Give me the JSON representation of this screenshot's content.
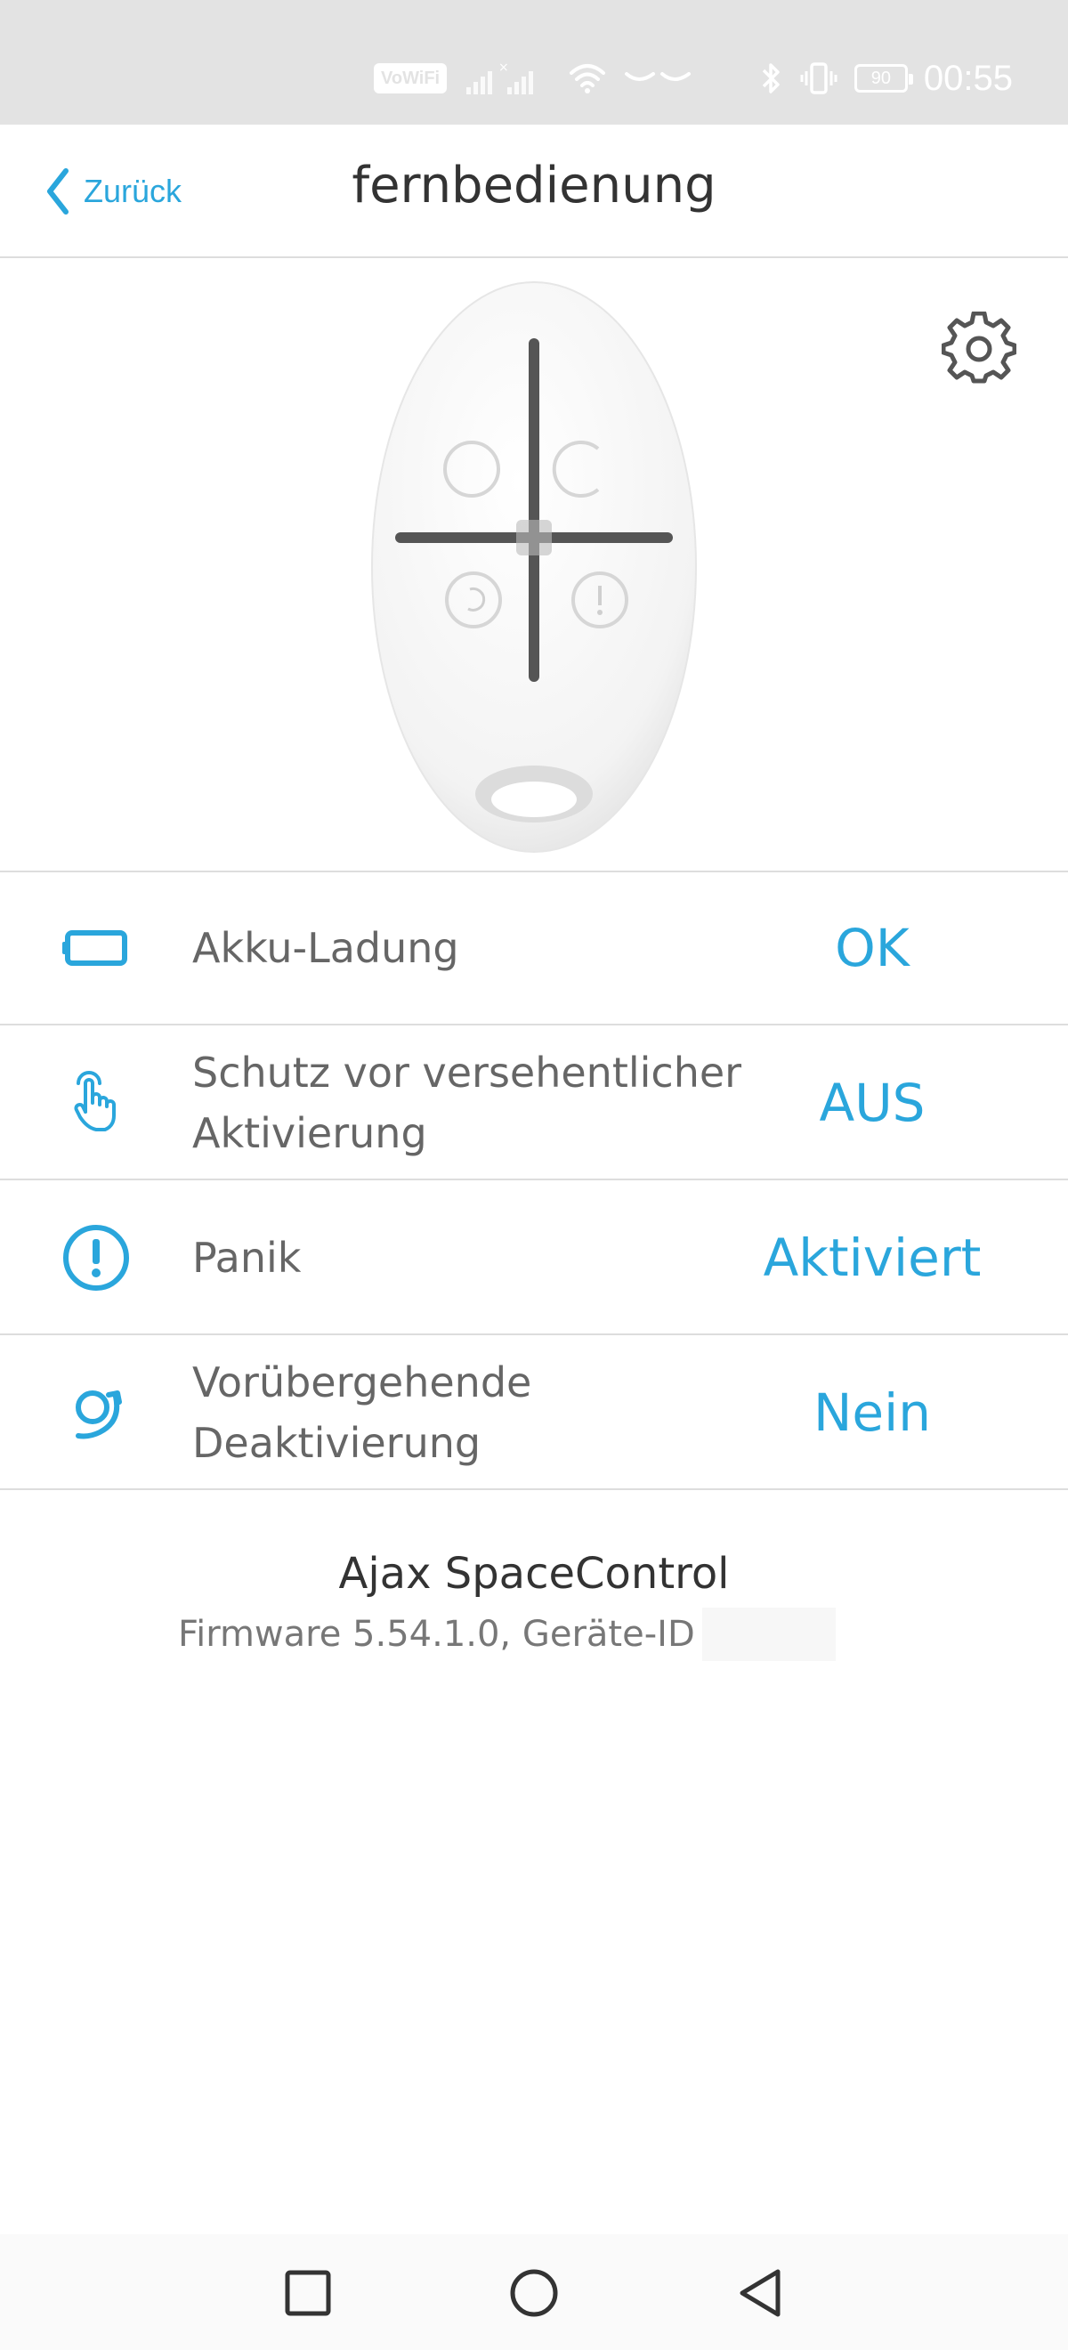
{
  "status_bar": {
    "vowifi": "VoWiFi",
    "battery_level": "90",
    "time": "00:55"
  },
  "header": {
    "back_label": "Zurück",
    "title": "fernbedienung"
  },
  "settings": [
    {
      "label": "Akku-Ladung",
      "value": "OK",
      "icon": "battery-icon"
    },
    {
      "label": "Schutz vor versehentlicher Aktivierung",
      "value": "AUS",
      "icon": "touch-hand-icon"
    },
    {
      "label": "Panik",
      "value": "Aktiviert",
      "icon": "exclamation-circle-icon"
    },
    {
      "label": "Vorübergehende Deaktivierung",
      "value": "Nein",
      "icon": "temporary-deactivation-icon"
    }
  ],
  "device": {
    "name": "Ajax SpaceControl",
    "info": "Firmware 5.54.1.0, Geräte-ID"
  },
  "colors": {
    "accent": "#2aa6dc",
    "status_bar_bg": "#e3e3e3",
    "divider": "#dddddd"
  }
}
